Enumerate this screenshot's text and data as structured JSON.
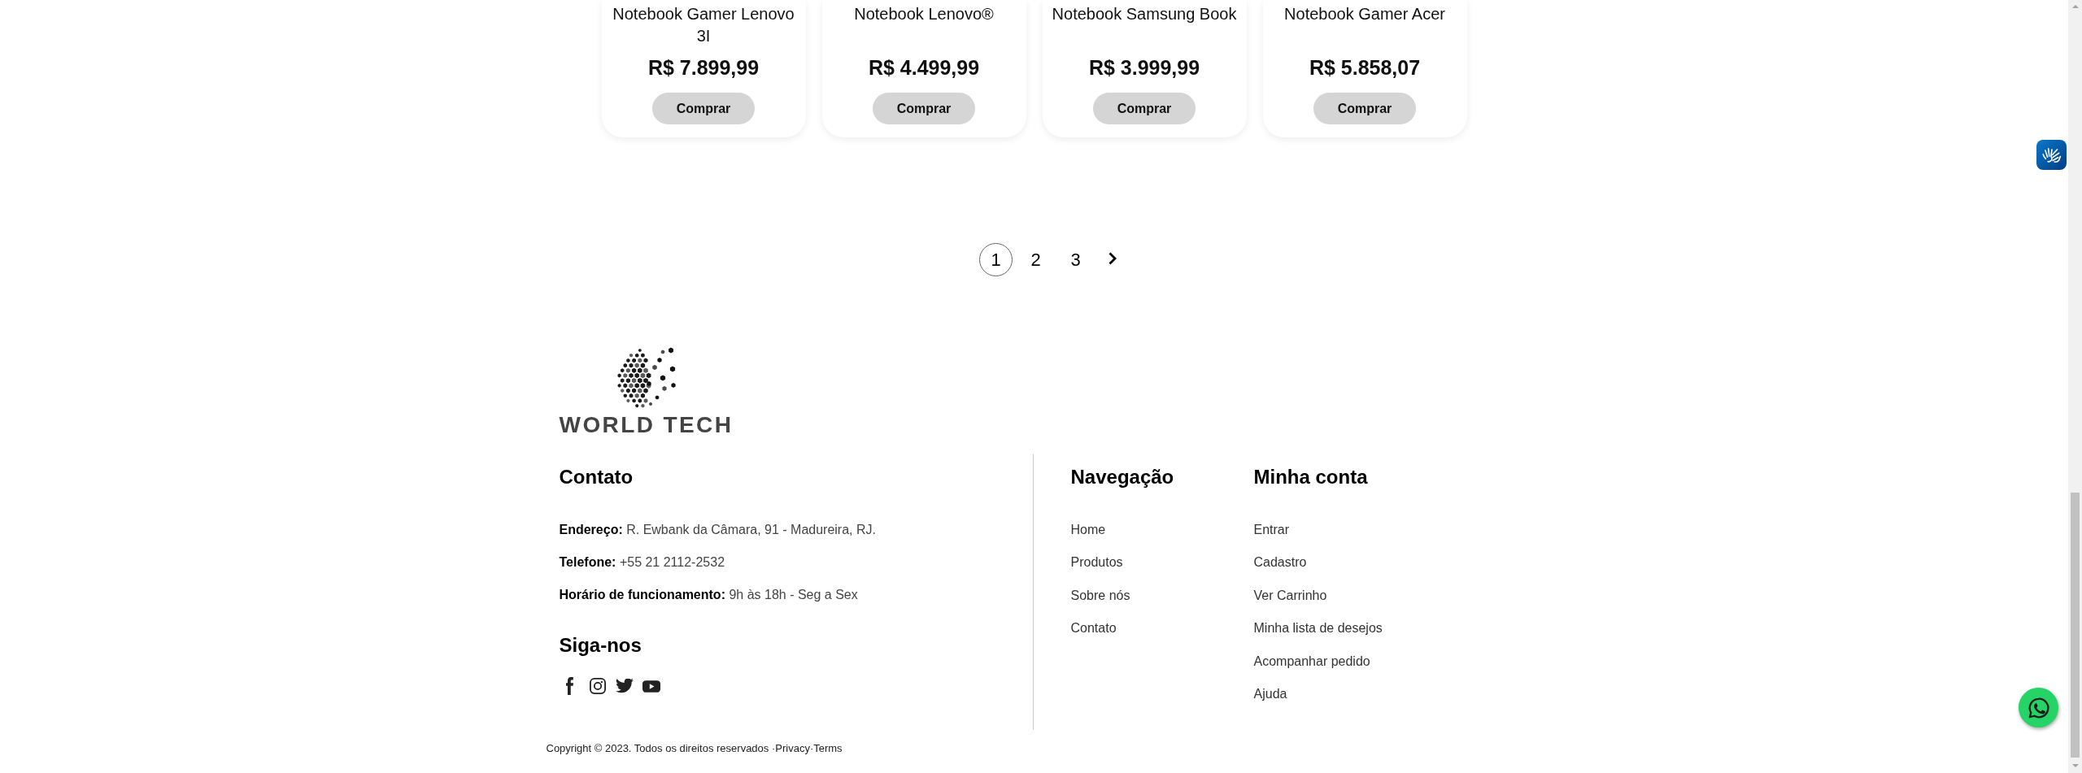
{
  "products": [
    {
      "name": "Notebook Gamer Lenovo 3I",
      "price": "R$ 7.899,99",
      "action": "Comprar"
    },
    {
      "name": "Notebook Lenovo®",
      "price": "R$ 4.499,99",
      "action": "Comprar"
    },
    {
      "name": "Notebook Samsung Book",
      "price": "R$ 3.999,99",
      "action": "Comprar"
    },
    {
      "name": "Notebook Gamer Acer",
      "price": "R$ 5.858,07",
      "action": "Comprar"
    }
  ],
  "pagination": {
    "pages": [
      {
        "label": "1",
        "selected": true
      },
      {
        "label": "2",
        "selected": false
      },
      {
        "label": "3",
        "selected": false
      }
    ]
  },
  "brand": {
    "name": "WORLD TECH"
  },
  "footer": {
    "contact": {
      "title": "Contato",
      "items": [
        {
          "label": "Endereço:",
          "value": "R. Ewbank da Câmara, 91 - Madureira, RJ."
        },
        {
          "label": "Telefone:",
          "value": "+55 21 2112-2532"
        },
        {
          "label": "Horário de funcionamento:",
          "value": "9h às 18h - Seg a Sex"
        }
      ]
    },
    "social": {
      "title": "Siga-nos"
    },
    "navigation": {
      "title": "Navegação",
      "links": [
        "Home",
        "Produtos",
        "Sobre nós",
        "Contato"
      ]
    },
    "account": {
      "title": "Minha conta",
      "links": [
        "Entrar",
        "Cadastro",
        "Ver Carrinho",
        "Minha lista de desejos",
        "Acompanhar pedido",
        "Ajuda"
      ]
    }
  },
  "copyright": {
    "text": "Copyright © 2023. Todos os direitos reservados ·",
    "separator": "·",
    "links": [
      "Privacy",
      "Terms"
    ]
  }
}
